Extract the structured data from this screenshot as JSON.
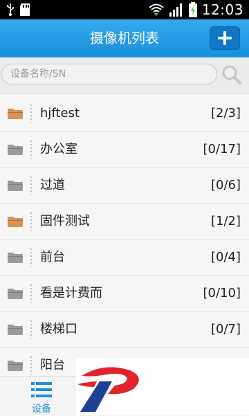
{
  "status": {
    "time": "12:03"
  },
  "header": {
    "title": "摄像机列表"
  },
  "search": {
    "placeholder": "设备名称/SN",
    "value": ""
  },
  "list": [
    {
      "name": "hjftest",
      "count": "[2/3]",
      "folder_color": "#d99255"
    },
    {
      "name": "办公室",
      "count": "[0/17]",
      "folder_color": "#9a9a9a"
    },
    {
      "name": "过道",
      "count": "[0/6]",
      "folder_color": "#9a9a9a"
    },
    {
      "name": "固件测试",
      "count": "[1/2]",
      "folder_color": "#d99255"
    },
    {
      "name": "前台",
      "count": "[0/4]",
      "folder_color": "#9a9a9a"
    },
    {
      "name": "看是计费而",
      "count": "[0/10]",
      "folder_color": "#9a9a9a"
    },
    {
      "name": "楼梯口",
      "count": "[0/7]",
      "folder_color": "#9a9a9a"
    },
    {
      "name": "阳台",
      "count": "",
      "folder_color": "#9a9a9a"
    }
  ],
  "bottom_tabs": [
    {
      "label": "设备",
      "icon": "list-icon",
      "active": true
    }
  ],
  "colors": {
    "accent": "#1a8fdc",
    "online_folder": "#d99255",
    "offline_folder": "#9a9a9a"
  }
}
